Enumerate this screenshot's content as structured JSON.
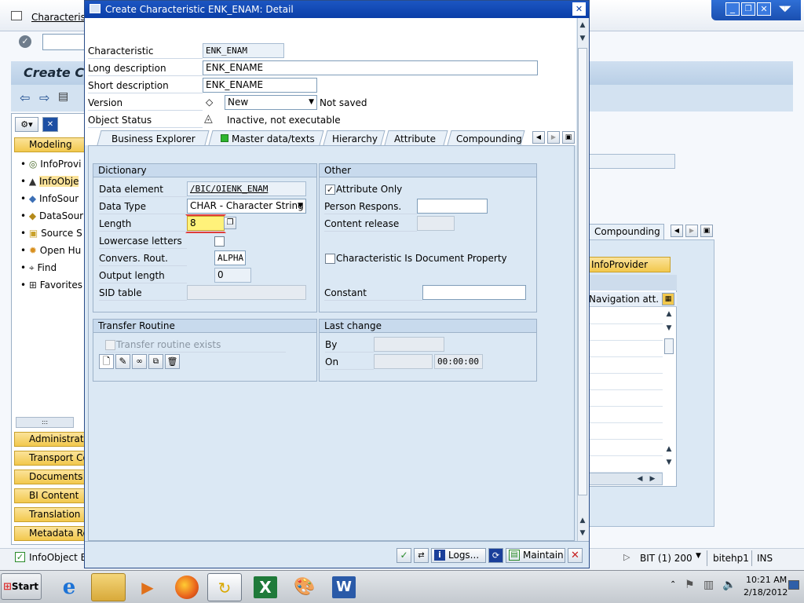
{
  "bg": {
    "window_title": "Characteristi",
    "page_title": "Create Ch",
    "menu": {
      "modeling": "Modeling"
    },
    "tree": [
      "InfoProvi",
      "InfoObje",
      "InfoSour",
      "DataSour",
      "Source S",
      "Open Hu",
      "Find",
      "Favorites"
    ],
    "bottom_buttons": [
      "Administratio",
      "Transport Co",
      "Documents",
      "BI Content",
      "Translation",
      "Metadata Re"
    ],
    "tab_compounding": "Compounding",
    "infoprovider_btn": "InfoProvider",
    "nav_att_header": "Navigation att. de",
    "status_left": "InfoObject E",
    "status_system": "BIT (1) 200",
    "status_host": "bitehp1",
    "status_mode": "INS"
  },
  "dialog": {
    "title": "Create Characteristic ENK_ENAM: Detail",
    "header": {
      "characteristic_label": "Characteristic",
      "characteristic_value": "ENK_ENAM",
      "long_desc_label": "Long description",
      "long_desc_value": "ENK_ENAME",
      "short_desc_label": "Short description",
      "short_desc_value": "ENK_ENAME",
      "version_label": "Version",
      "version_value": "New",
      "version_status": "Not saved",
      "object_status_label": "Object Status",
      "object_status_value": "Inactive, not executable"
    },
    "tabs": [
      "Business Explorer",
      "Master data/texts",
      "Hierarchy",
      "Attribute",
      "Compounding"
    ],
    "dictionary": {
      "title": "Dictionary",
      "data_element_label": "Data element",
      "data_element_value": "/BIC/OIENK_ENAM",
      "data_type_label": "Data Type",
      "data_type_value": "CHAR - Character String",
      "length_label": "Length",
      "length_value": "8",
      "lowercase_label": "Lowercase letters",
      "convers_label": "Convers. Rout.",
      "convers_value": "ALPHA",
      "output_length_label": "Output length",
      "output_length_value": "0",
      "sid_table_label": "SID table"
    },
    "other": {
      "title": "Other",
      "attribute_only_label": "Attribute Only",
      "person_label": "Person Respons.",
      "content_release_label": "Content release",
      "doc_property_label": "Characteristic Is Document Property",
      "constant_label": "Constant"
    },
    "transfer": {
      "title": "Transfer Routine",
      "exists_label": "Transfer routine exists"
    },
    "last_change": {
      "title": "Last change",
      "by_label": "By",
      "on_label": "On",
      "time_value": "00:00:00"
    },
    "footer": {
      "logs_label": "Logs...",
      "maintain_label": "Maintain"
    }
  },
  "taskbar": {
    "start_label": "Start",
    "clock_time": "10:21 AM",
    "clock_date": "2/18/2012"
  },
  "colors": {
    "title_bar": "#0a3ea8",
    "panel_bg": "#dbe8f4",
    "accent_yellow": "#f7d14a"
  }
}
